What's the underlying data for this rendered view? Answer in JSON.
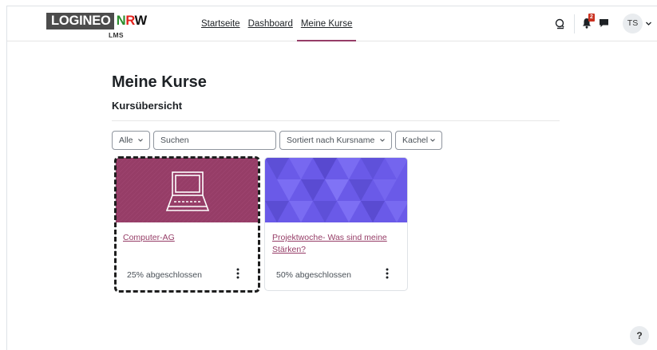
{
  "brand": {
    "logo_left": "LOGINEO",
    "logo_n": "N",
    "logo_r": "R",
    "logo_w": "W",
    "logo_sub": "LMS"
  },
  "nav": {
    "links": [
      "Startseite",
      "Dashboard",
      "Meine Kurse"
    ],
    "active": "Meine Kurse"
  },
  "user": {
    "initials": "TS",
    "notification_count": "2"
  },
  "page": {
    "title": "Meine Kurse",
    "section_title": "Kursübersicht"
  },
  "filters": {
    "grouping": "Alle",
    "search_placeholder": "Suchen",
    "sort": "Sortiert nach Kursname",
    "view": "Kachel"
  },
  "courses": [
    {
      "name": "Computer-AG",
      "progress_text": "25% abgeschlossen",
      "progress": 25,
      "image_color": "#963d67",
      "icon": "laptop-icon"
    },
    {
      "name": "Projektwoche- Was sind meine Stärken?",
      "progress_text": "50% abgeschlossen",
      "progress": 50,
      "image_color": "#6a5ae8",
      "icon": "triangle-pattern"
    }
  ],
  "colors": {
    "brand_accent": "#963d67",
    "pattern_base": "#6a5ae8",
    "badge": "#ca3120"
  },
  "help": {
    "label": "?"
  }
}
